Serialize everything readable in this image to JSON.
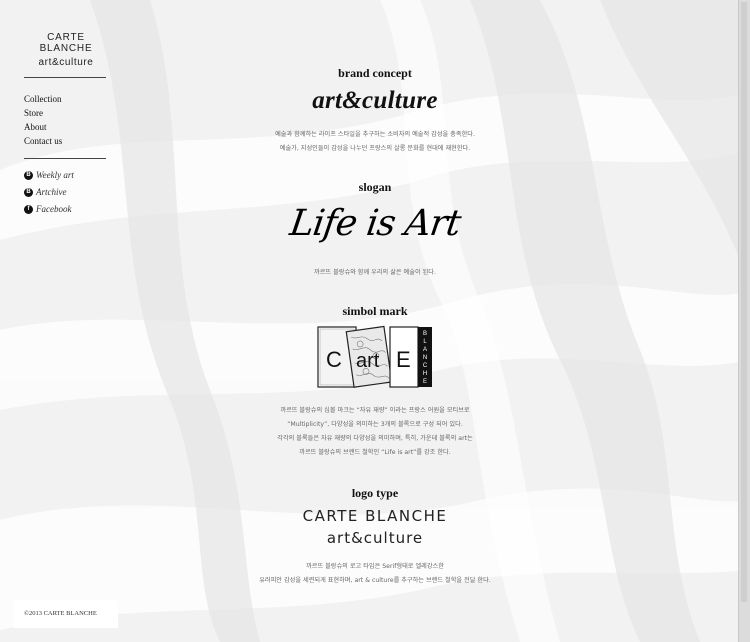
{
  "sidebar": {
    "brand_line1": "CARTE BLANCHE",
    "brand_line2": "art&culture",
    "menu": [
      "Collection",
      "Store",
      "About",
      "Contact us"
    ],
    "social": [
      {
        "icon": "blog-icon",
        "badge": "B",
        "label": "Weekly art"
      },
      {
        "icon": "blog-icon",
        "badge": "B",
        "label": "Artchive"
      },
      {
        "icon": "facebook-icon",
        "badge": "f",
        "label": "Facebook"
      }
    ]
  },
  "main": {
    "concept": {
      "heading": "brand concept",
      "title": "art&culture",
      "desc_line1": "예술과 함께하는 라이프 스타일을 추구하는 소비자의 예술적 감성을 충족한다.",
      "desc_line2": "예술가, 지성인들이 감성을 나누던 프랑스의 살롱 문화를 현대에 재현한다."
    },
    "slogan": {
      "heading": "slogan",
      "title": "Life is Art",
      "desc": "까르뜨 블랑슈와 함께 우리의 삶은 예술이 된다."
    },
    "mark": {
      "heading": "simbol mark",
      "logo_text": "CartE",
      "logo_side": "BLANCHE",
      "desc_line1": "까르뜨 블랑슈의 심볼 마크는 “자유 재량” 이라는 프랑스 어원을 모티브로",
      "desc_line2": "“Multiplicity”, 다양성을 의미하는 3개의 블록으로 구성 되어 있다.",
      "desc_line3": "각각의 블록들은 자유 재량의 다양성을 의미하며, 특히, 가운데 블록의 art는",
      "desc_line4": "까르뜨 블랑슈의 브랜드 철학인 “Life is art”를 강조 한다."
    },
    "logotype": {
      "heading": "logo type",
      "line1": "CARTE BLANCHE",
      "line2": "art&culture",
      "desc_line1": "까르뜨 블랑슈의 로고 타입은 Serif형태로 엘레강스한",
      "desc_line2": "유러피안 감성을 세련되게 표현하며, art & culture를 추구하는 브랜드 철학을 전달 한다."
    }
  },
  "footer": {
    "copyright": "©2013 CARTE BLANCHE"
  }
}
